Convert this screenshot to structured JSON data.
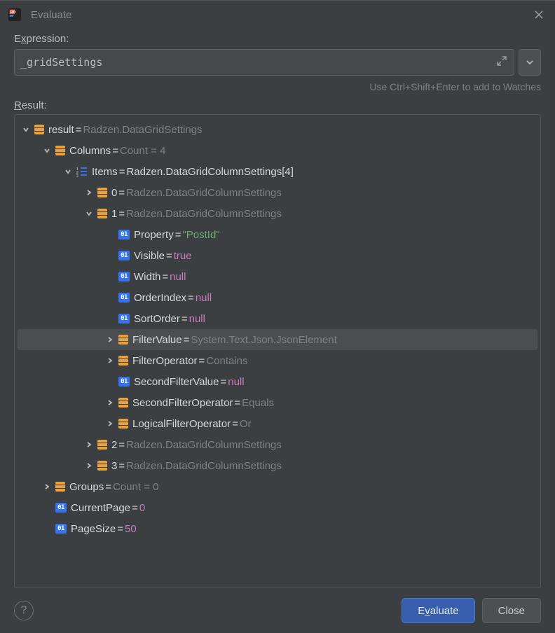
{
  "title": "Evaluate",
  "expressionLabel": "Expression:",
  "expressionValue": "_gridSettings",
  "hint": "Use Ctrl+Shift+Enter to add to Watches",
  "resultLabel": "Result:",
  "buttons": {
    "evaluate": "Evaluate",
    "close": "Close"
  },
  "tree": {
    "result": {
      "name": "result",
      "value": "Radzen.DataGridSettings"
    },
    "columns": {
      "name": "Columns",
      "value": "Count = 4"
    },
    "items": {
      "name": "Items",
      "value": "Radzen.DataGridColumnSettings[4]"
    },
    "i0": {
      "name": "0",
      "value": "Radzen.DataGridColumnSettings"
    },
    "i1": {
      "name": "1",
      "value": "Radzen.DataGridColumnSettings"
    },
    "p_property": {
      "name": "Property",
      "value": "\"PostId\""
    },
    "p_visible": {
      "name": "Visible",
      "value": "true"
    },
    "p_width": {
      "name": "Width",
      "value": "null"
    },
    "p_orderindex": {
      "name": "OrderIndex",
      "value": "null"
    },
    "p_sortorder": {
      "name": "SortOrder",
      "value": "null"
    },
    "p_filtervalue": {
      "name": "FilterValue",
      "value": "System.Text.Json.JsonElement"
    },
    "p_filterop": {
      "name": "FilterOperator",
      "value": "Contains"
    },
    "p_secfiltval": {
      "name": "SecondFilterValue",
      "value": "null"
    },
    "p_secfilop": {
      "name": "SecondFilterOperator",
      "value": "Equals"
    },
    "p_logop": {
      "name": "LogicalFilterOperator",
      "value": "Or"
    },
    "i2": {
      "name": "2",
      "value": "Radzen.DataGridColumnSettings"
    },
    "i3": {
      "name": "3",
      "value": "Radzen.DataGridColumnSettings"
    },
    "groups": {
      "name": "Groups",
      "value": "Count = 0"
    },
    "currentpage": {
      "name": "CurrentPage",
      "value": "0"
    },
    "pagesize": {
      "name": "PageSize",
      "value": "50"
    }
  }
}
